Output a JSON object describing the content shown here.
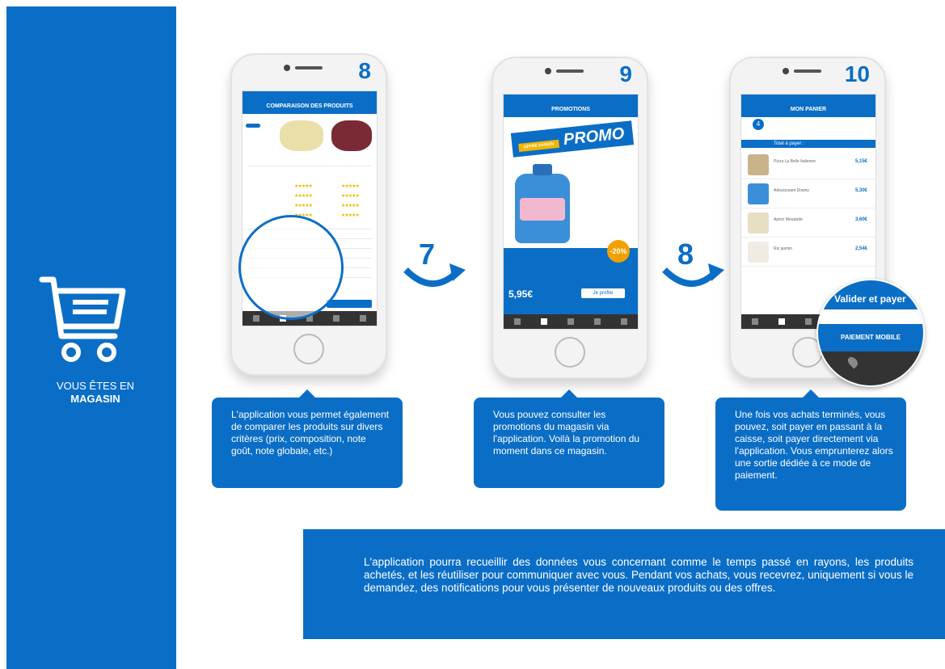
{
  "sidebar": {
    "line1": "VOUS ÊTES EN",
    "line2": "MAGASIN"
  },
  "steps": [
    {
      "number": "8",
      "screen_title": "COMPARAISON DES PRODUITS"
    },
    {
      "number": "9",
      "screen_title": "PROMOTIONS"
    },
    {
      "number": "10",
      "screen_title": "MON PANIER"
    }
  ],
  "arrows": [
    "7",
    "8"
  ],
  "promo": {
    "word": "PROMO",
    "tag": "OFFRE SAISON",
    "badge": "-20%",
    "price": "5,95€",
    "button": "Je profite"
  },
  "cart": {
    "count": "4",
    "total_label": "Total à payer :",
    "items": [
      {
        "name": "Pizza La Belle Italienne",
        "price": "5,15€"
      },
      {
        "name": "Adoucissant Downy",
        "price": "5,30€"
      },
      {
        "name": "Apéro Moutarde",
        "price": "3,60€"
      },
      {
        "name": "Riz jasmin",
        "price": "2,54€"
      }
    ],
    "validate": "Valider et payer",
    "mobile_pay": "PAIEMENT MOBILE"
  },
  "bubbles": [
    "L'application vous permet également de comparer les produits sur divers critères (prix, composition, note goût, note globale, etc.)",
    "Vous pouvez consulter les promotions du magasin via l'application. Voilà la promotion du moment dans ce magasin.",
    "Une fois vos achats terminés, vous pouvez, soit payer en passant à la caisse, soit payer directement via l'application. Vous emprunterez alors une sortie dédiée à ce mode de paiement."
  ],
  "bottom_text": "L'application pourra recueillir des données vous concernant comme le temps passé en rayons, les produits achetés, et les réutiliser pour communiquer avec vous. Pendant vos achats, vous recevrez, uniquement si vous le demandez, des notifications pour vous présenter de nouveaux produits ou des offres.",
  "colors": {
    "brand_blue": "#0b6ec6",
    "accent_yellow": "#f2b600"
  }
}
